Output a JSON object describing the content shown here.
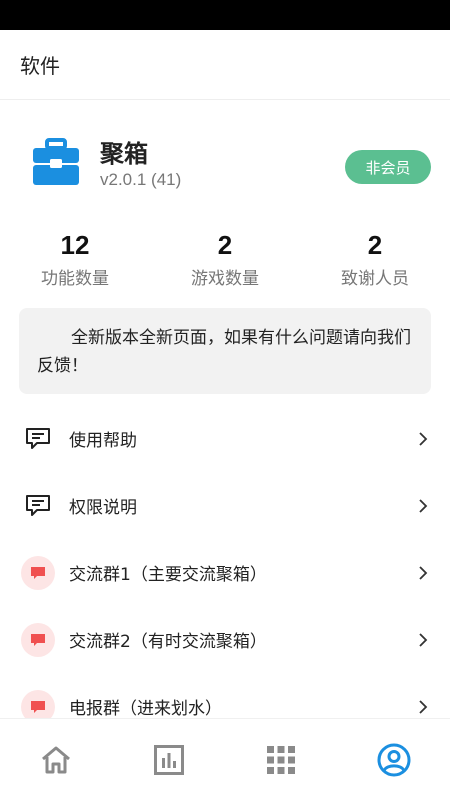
{
  "app_bar": {
    "title": "软件"
  },
  "profile": {
    "name": "聚箱",
    "version": "v2.0.1 (41)",
    "member_badge": "非会员"
  },
  "stats": [
    {
      "value": "12",
      "label": "功能数量"
    },
    {
      "value": "2",
      "label": "游戏数量"
    },
    {
      "value": "2",
      "label": "致谢人员"
    }
  ],
  "notice": {
    "text": "全新版本全新页面，如果有什么问题请向我们反馈！"
  },
  "menu": {
    "items": [
      {
        "label": "使用帮助",
        "icon": "chat-bubble-icon"
      },
      {
        "label": "权限说明",
        "icon": "chat-bubble-icon"
      },
      {
        "label": "交流群1（主要交流聚箱）",
        "icon": "group-chat-icon"
      },
      {
        "label": "交流群2（有时交流聚箱）",
        "icon": "group-chat-icon"
      },
      {
        "label": "电报群（进来划水）",
        "icon": "group-chat-icon"
      }
    ]
  },
  "bottom_nav": {
    "items": [
      "home-icon",
      "chart-icon",
      "apps-grid-icon",
      "profile-icon"
    ],
    "active_index": 3
  },
  "colors": {
    "accent": "#1b8fe0",
    "badge": "#5bbf91",
    "group_icon_bg": "#fde5e5",
    "group_icon": "#f05050",
    "nav_inactive": "#8a8a8a"
  }
}
